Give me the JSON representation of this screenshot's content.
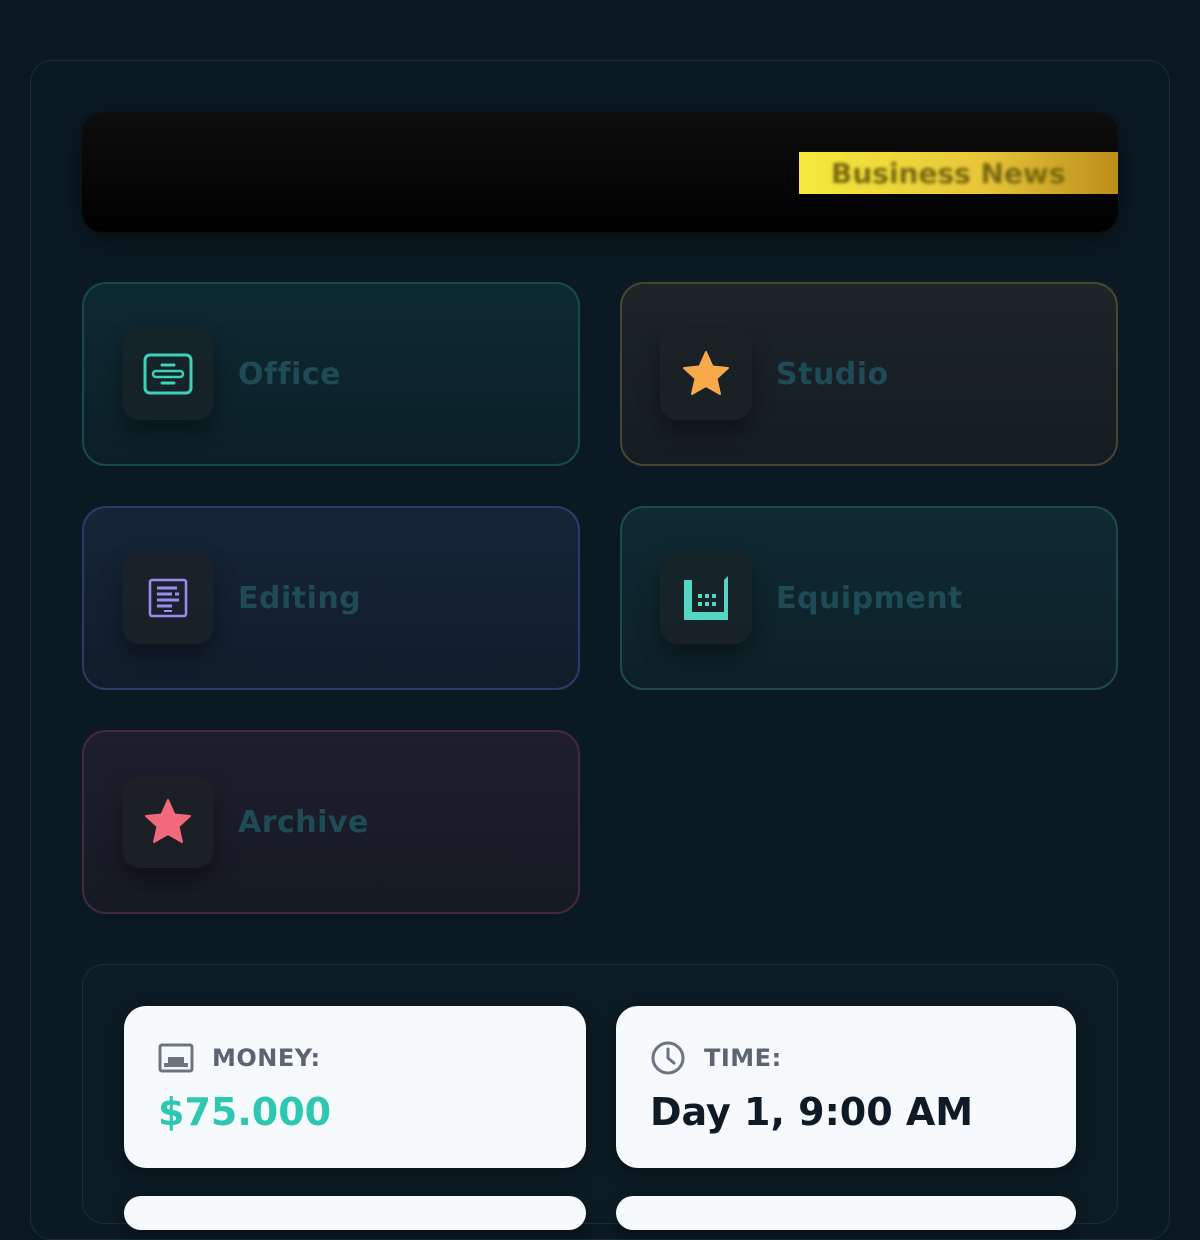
{
  "banner": {
    "ticker_text": "Business News"
  },
  "locations": [
    {
      "id": "office",
      "label": "Office",
      "icon": "office-icon",
      "accent": "#3fd1b8"
    },
    {
      "id": "studio",
      "label": "Studio",
      "icon": "star-icon",
      "accent": "#f8a94a"
    },
    {
      "id": "editing",
      "label": "Editing",
      "icon": "document-icon",
      "accent": "#9b8cf2"
    },
    {
      "id": "equipment",
      "label": "Equipment",
      "icon": "factory-icon",
      "accent": "#54d6c2"
    },
    {
      "id": "archive",
      "label": "Archive",
      "icon": "star-icon",
      "accent": "#f06a7c"
    }
  ],
  "stats": {
    "money": {
      "label": "MONEY:",
      "value": "$75.000",
      "icon": "wallet-icon",
      "color": "#2ec7b2"
    },
    "time": {
      "label": "TIME:",
      "value": "Day 1, 9:00 AM",
      "icon": "clock-icon",
      "color": "#0e1a26"
    }
  }
}
